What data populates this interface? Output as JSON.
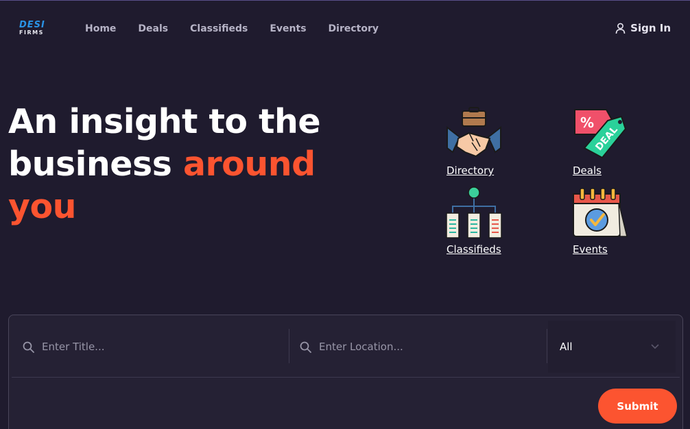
{
  "header": {
    "logo": {
      "line1": "DESI",
      "line2": "FIRMS"
    },
    "nav": [
      {
        "label": "Home"
      },
      {
        "label": "Deals"
      },
      {
        "label": "Classifieds"
      },
      {
        "label": "Events"
      },
      {
        "label": "Directory"
      }
    ],
    "signin": {
      "label": "Sign In",
      "icon": "user-icon"
    }
  },
  "hero": {
    "line1": "An insight to the",
    "line2_plain": "business ",
    "line2_accent": "around",
    "line3_accent": "you"
  },
  "categories": [
    {
      "label": "Directory",
      "icon": "handshake-icon"
    },
    {
      "label": "Deals",
      "icon": "deal-tag-icon"
    },
    {
      "label": "Classifieds",
      "icon": "classifieds-network-icon"
    },
    {
      "label": "Events",
      "icon": "calendar-check-icon"
    }
  ],
  "search": {
    "title_placeholder": "Enter Title...",
    "location_placeholder": "Enter Location...",
    "select_value": "All",
    "submit_label": "Submit"
  },
  "colors": {
    "background": "#1f1b2e",
    "accent": "#fc5430",
    "nav_text": "#b6b3c6",
    "logo_blue": "#2a93e6"
  }
}
